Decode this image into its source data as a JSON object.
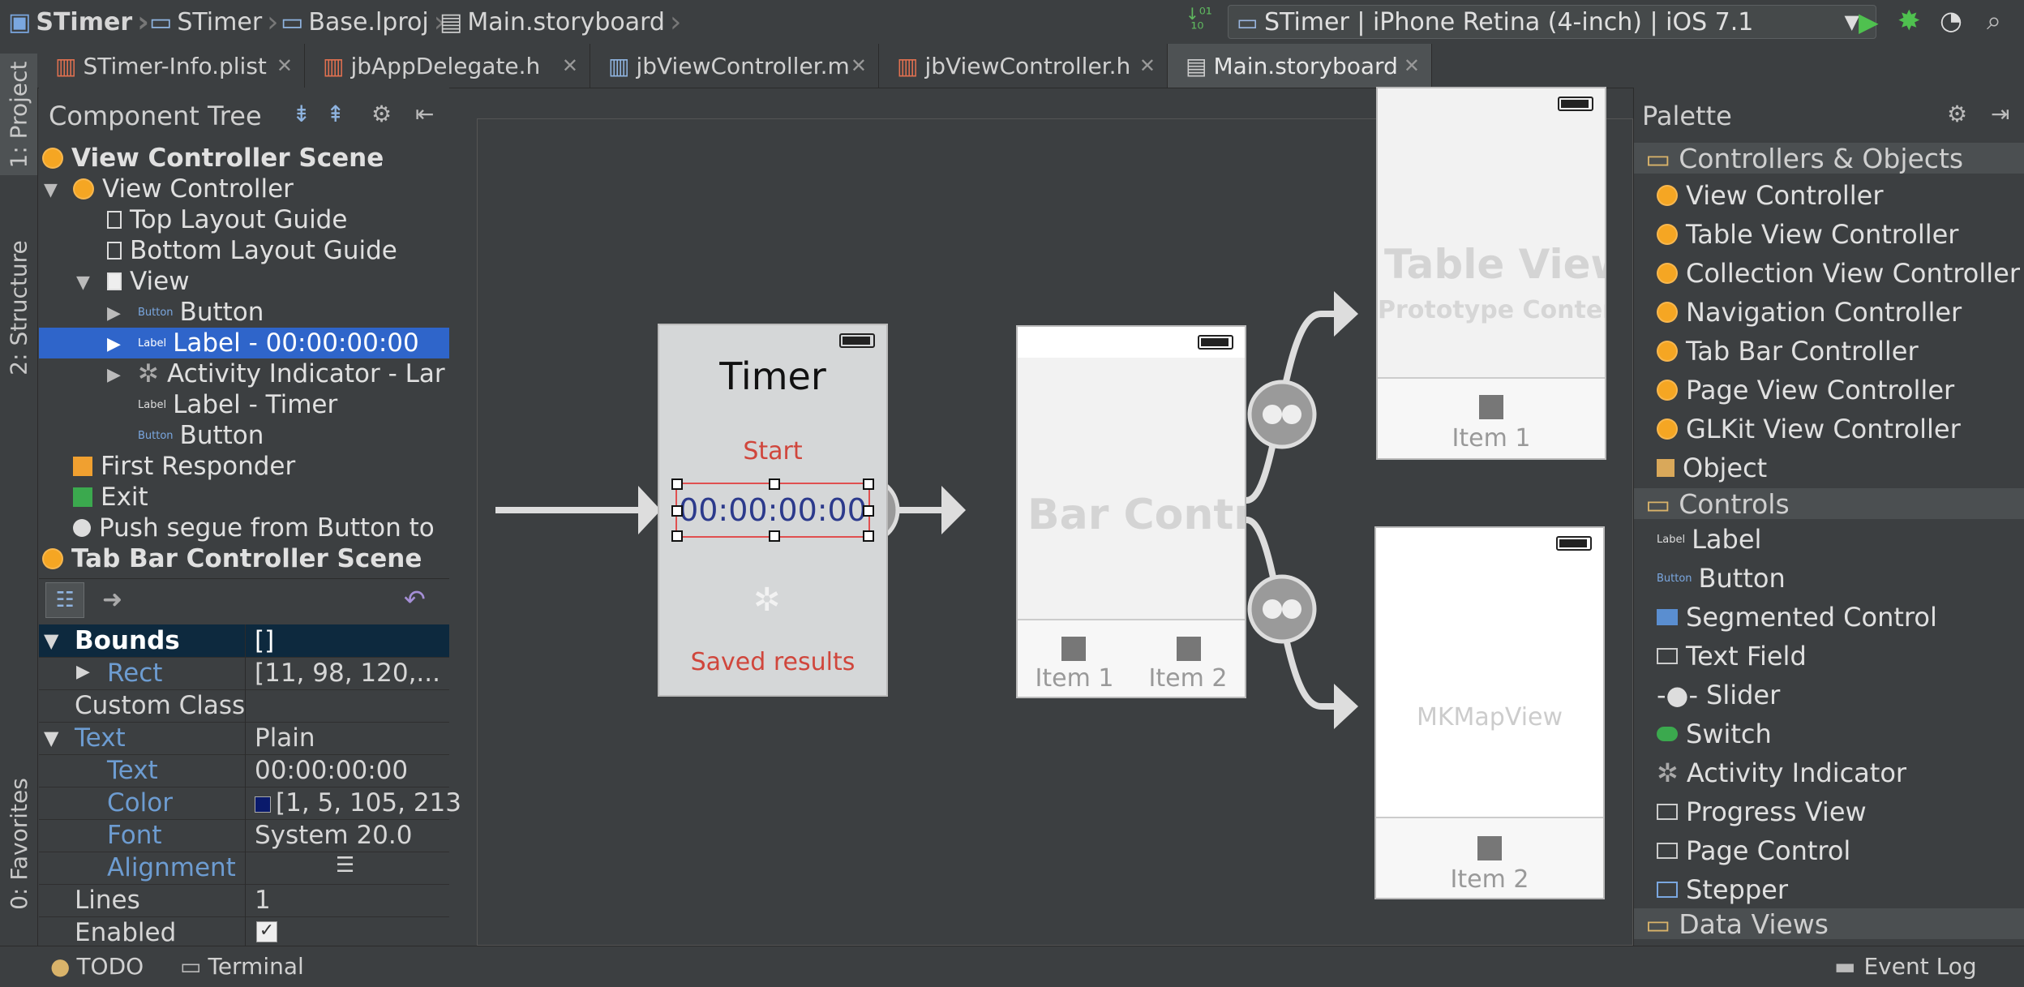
{
  "navbar": {
    "crumbs": [
      "STimer",
      "STimer",
      "Base.lproj",
      "Main.storyboard"
    ],
    "run_config": "STimer | iPhone Retina (4-inch) | iOS 7.1"
  },
  "tabs": [
    {
      "label": "STimer-Info.plist"
    },
    {
      "label": "jbAppDelegate.h"
    },
    {
      "label": "jbViewController.m"
    },
    {
      "label": "jbViewController.h"
    },
    {
      "label": "Main.storyboard"
    }
  ],
  "side_tabs": {
    "project": "1: Project",
    "structure": "2: Structure",
    "favorites": "0: Favorites"
  },
  "component_tree": {
    "title": "Component Tree",
    "nodes": [
      "View Controller Scene",
      "View Controller",
      "Top Layout Guide",
      "Bottom Layout Guide",
      "View",
      "Button",
      "Label - 00:00:00:00",
      "Activity Indicator - Lar",
      "Label - Timer",
      "Button",
      "First Responder",
      "Exit",
      "Push segue from Button to",
      "Tab Bar Controller Scene"
    ],
    "icon_label": "Label",
    "icon_button": "Button"
  },
  "properties": {
    "rows": [
      {
        "key": "Bounds",
        "value": "[]"
      },
      {
        "key": "Rect",
        "value": "[11, 98, 120,..."
      },
      {
        "key": "Custom Class",
        "value": ""
      },
      {
        "key": "Text",
        "value": "Plain"
      },
      {
        "key": "Text",
        "value": "00:00:00:00"
      },
      {
        "key": "Color",
        "value": "[1, 5, 105, 213"
      },
      {
        "key": "Font",
        "value": "System 20.0"
      },
      {
        "key": "Alignment",
        "value": ""
      },
      {
        "key": "Lines",
        "value": "1"
      },
      {
        "key": "Enabled",
        "value": ""
      }
    ],
    "swatch_color": "#0a1a6b"
  },
  "storyboard": {
    "timer_title": "Timer",
    "start": "Start",
    "time_value": "00:00:00:00",
    "saved": "Saved results",
    "tab_bar_title": "Bar Contro",
    "item1": "Item 1",
    "item2": "Item 2",
    "table_view_title": "Table View",
    "table_view_sub": "Prototype Content",
    "table_item": "Item 1",
    "map_title": "MKMapView",
    "map_item": "Item 2",
    "accent_red": "#d0463c",
    "time_blue": "#2c3a8c"
  },
  "palette": {
    "title": "Palette",
    "cat_controllers": "Controllers & Objects",
    "controllers": [
      "View Controller",
      "Table View Controller",
      "Collection View Controller",
      "Navigation Controller",
      "Tab Bar Controller",
      "Page View Controller",
      "GLKit View Controller",
      "Object"
    ],
    "cat_controls": "Controls",
    "controls": [
      "Label",
      "Button",
      "Segmented Control",
      "Text Field",
      "Slider",
      "Switch",
      "Activity Indicator",
      "Progress View",
      "Page Control",
      "Stepper"
    ],
    "cat_data": "Data Views"
  },
  "bottom": {
    "todo": "TODO",
    "terminal": "Terminal",
    "event_log": "Event Log"
  }
}
